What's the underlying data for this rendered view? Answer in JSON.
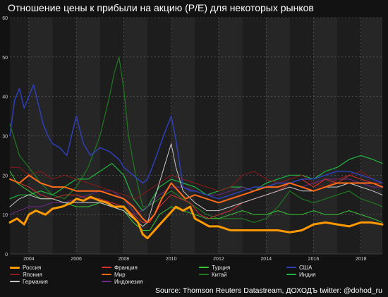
{
  "chart_data": {
    "type": "line",
    "title": "Отношение цены к прибыли на акцию (P/E) для некоторых рынков",
    "source": "Source: Thomson Reuters Datastream, ДОХОДЪ twitter: @dohod_ru",
    "xlim": [
      2003.2,
      2018.9
    ],
    "ylim": [
      0,
      60
    ],
    "x_ticks": [
      "2004",
      "2006",
      "2008",
      "2010",
      "2012",
      "2014",
      "2016",
      "2018"
    ],
    "y_ticks": [
      "0",
      "10",
      "20",
      "30",
      "40",
      "50",
      "60"
    ],
    "grid": true,
    "legend_position": "bottom",
    "series": [
      {
        "name": "Россия",
        "color": "#ff9900",
        "width": 3.0,
        "x": [
          2003.2,
          2003.5,
          2003.8,
          2004.0,
          2004.3,
          2004.7,
          2005.0,
          2005.4,
          2005.8,
          2006.0,
          2006.3,
          2006.6,
          2007.0,
          2007.3,
          2007.6,
          2008.0,
          2008.3,
          2008.6,
          2008.8,
          2009.0,
          2009.3,
          2009.6,
          2009.9,
          2010.2,
          2010.5,
          2010.8,
          2011.0,
          2011.3,
          2011.6,
          2012.0,
          2012.5,
          2013.0,
          2013.5,
          2014.0,
          2014.5,
          2015.0,
          2015.5,
          2016.0,
          2016.5,
          2017.0,
          2017.5,
          2018.0,
          2018.4,
          2018.9
        ],
        "y": [
          8,
          9,
          7.5,
          10,
          11,
          10,
          11.5,
          12,
          13,
          14,
          13.5,
          14.5,
          13.5,
          13,
          12,
          12,
          10,
          8,
          5,
          4,
          6,
          8,
          10,
          12,
          11,
          12,
          9,
          8,
          7,
          7,
          6,
          6,
          6,
          6,
          6,
          5.5,
          6,
          7.5,
          8,
          7.5,
          7,
          8,
          8,
          7.5
        ]
      },
      {
        "name": "Франция",
        "color": "#d92f2f",
        "width": 1.0,
        "x": [
          2003.2,
          2003.6,
          2004.0,
          2004.5,
          2005.0,
          2005.5,
          2006.0,
          2006.5,
          2007.0,
          2007.5,
          2008.0,
          2008.4,
          2008.8,
          2009.1,
          2009.5,
          2010.0,
          2010.4,
          2010.8,
          2011.2,
          2011.6,
          2012.0,
          2012.5,
          2013.0,
          2013.5,
          2014.0,
          2014.5,
          2015.0,
          2015.5,
          2016.0,
          2016.5,
          2017.0,
          2017.5,
          2018.0,
          2018.5,
          2018.9
        ],
        "y": [
          19,
          18,
          17,
          15,
          14,
          15,
          15,
          14,
          14,
          13,
          12,
          10,
          8,
          8,
          12,
          15,
          14,
          13,
          10,
          9,
          10,
          11,
          13,
          14,
          15,
          16,
          18,
          19,
          17,
          19,
          18,
          20,
          19,
          18,
          18
        ]
      },
      {
        "name": "Турция",
        "color": "#37c837",
        "width": 1.0,
        "x": [
          2003.2,
          2003.5,
          2004.0,
          2004.5,
          2005.0,
          2005.5,
          2006.0,
          2006.5,
          2007.0,
          2007.5,
          2008.0,
          2008.4,
          2008.8,
          2009.1,
          2009.5,
          2010.0,
          2010.5,
          2011.0,
          2011.5,
          2012.0,
          2012.5,
          2013.0,
          2013.5,
          2014.0,
          2014.5,
          2015.0,
          2015.5,
          2016.0,
          2016.5,
          2017.0,
          2017.5,
          2018.0,
          2018.5,
          2018.9
        ],
        "y": [
          21,
          18,
          16,
          14,
          14,
          13,
          12,
          12,
          13,
          12,
          11,
          8,
          6,
          6,
          10,
          12,
          11,
          10,
          9,
          9,
          10,
          11,
          10,
          10,
          11,
          10,
          10,
          11,
          10,
          10,
          11,
          10,
          9,
          8
        ]
      },
      {
        "name": "США",
        "color": "#2e3fb8",
        "width": 1.5,
        "x": [
          2003.2,
          2003.4,
          2003.6,
          2003.8,
          2004.0,
          2004.2,
          2004.4,
          2004.6,
          2004.8,
          2005.0,
          2005.3,
          2005.6,
          2006.0,
          2006.3,
          2006.6,
          2007.0,
          2007.4,
          2007.8,
          2008.0,
          2008.4,
          2008.8,
          2009.0,
          2009.2,
          2009.5,
          2009.8,
          2010.0,
          2010.2,
          2010.5,
          2010.8,
          2011.0,
          2011.5,
          2012.0,
          2012.5,
          2013.0,
          2013.5,
          2014.0,
          2014.5,
          2015.0,
          2015.5,
          2016.0,
          2016.5,
          2017.0,
          2017.5,
          2018.0,
          2018.5,
          2018.9
        ],
        "y": [
          30,
          39,
          42,
          37,
          40,
          43,
          38,
          33,
          30,
          28,
          27,
          25,
          35,
          28,
          25,
          27,
          26,
          24,
          22,
          20,
          18,
          19,
          22,
          27,
          32,
          35,
          29,
          17,
          16,
          16,
          15,
          14,
          15,
          16,
          17,
          17,
          18,
          18,
          19,
          19,
          20,
          21,
          21,
          20,
          19,
          18
        ]
      },
      {
        "name": "Япония",
        "color": "#8b1a1a",
        "width": 1.0,
        "x": [
          2003.2,
          2003.6,
          2004.0,
          2004.5,
          2005.0,
          2005.5,
          2006.0,
          2006.5,
          2007.0,
          2007.5,
          2008.0,
          2008.5,
          2009.0,
          2009.5,
          2010.0,
          2010.5,
          2011.0,
          2011.5,
          2012.0,
          2012.5,
          2013.0,
          2013.5,
          2014.0,
          2014.5,
          2015.0,
          2015.5,
          2016.0,
          2016.5,
          2017.0,
          2017.5,
          2018.0,
          2018.5,
          2018.9
        ],
        "y": [
          22,
          22,
          20,
          21,
          19,
          20,
          19,
          18,
          17,
          16,
          15,
          14,
          16,
          18,
          20,
          19,
          18,
          17,
          16,
          17,
          20,
          21,
          19,
          18,
          19,
          20,
          18,
          17,
          19,
          20,
          21,
          19,
          18
        ]
      },
      {
        "name": "Мир",
        "color": "#ff6b18",
        "width": 2.0,
        "x": [
          2003.2,
          2003.6,
          2004.0,
          2004.5,
          2005.0,
          2005.5,
          2006.0,
          2006.5,
          2007.0,
          2007.5,
          2008.0,
          2008.4,
          2008.8,
          2009.0,
          2009.3,
          2009.6,
          2010.0,
          2010.3,
          2010.6,
          2011.0,
          2011.5,
          2012.0,
          2012.5,
          2013.0,
          2013.5,
          2014.0,
          2014.5,
          2015.0,
          2015.5,
          2016.0,
          2016.5,
          2017.0,
          2017.5,
          2018.0,
          2018.5,
          2018.9
        ],
        "y": [
          19,
          18,
          20,
          18,
          17,
          17,
          16,
          16,
          16,
          15,
          14,
          12,
          9,
          8,
          10,
          14,
          18,
          16,
          14,
          15,
          14,
          13,
          14,
          15,
          16,
          17,
          17,
          18,
          17,
          16,
          17,
          18,
          18,
          18,
          18,
          17
        ]
      },
      {
        "name": "Китай",
        "color": "#1f7a1f",
        "width": 1.2,
        "x": [
          2003.2,
          2003.6,
          2004.0,
          2004.5,
          2005.0,
          2005.5,
          2006.0,
          2006.5,
          2007.0,
          2007.4,
          2007.6,
          2007.8,
          2008.0,
          2008.2,
          2008.5,
          2008.8,
          2009.0,
          2009.5,
          2010.0,
          2010.5,
          2011.0,
          2011.5,
          2012.0,
          2012.5,
          2013.0,
          2013.5,
          2014.0,
          2014.5,
          2015.0,
          2015.5,
          2016.0,
          2016.5,
          2017.0,
          2017.5,
          2018.0,
          2018.5,
          2018.9
        ],
        "y": [
          33,
          25,
          22,
          18,
          15,
          14,
          17,
          22,
          30,
          40,
          46,
          50,
          42,
          30,
          20,
          12,
          12,
          14,
          16,
          14,
          12,
          10,
          9,
          9,
          9,
          8,
          9,
          12,
          16,
          14,
          13,
          14,
          15,
          16,
          14,
          13,
          12
        ]
      },
      {
        "name": "Индия",
        "color": "#20b540",
        "width": 1.2,
        "x": [
          2003.2,
          2003.6,
          2004.0,
          2004.5,
          2005.0,
          2005.5,
          2006.0,
          2006.5,
          2007.0,
          2007.5,
          2008.0,
          2008.4,
          2008.8,
          2009.0,
          2009.5,
          2010.0,
          2010.5,
          2011.0,
          2011.5,
          2012.0,
          2012.5,
          2013.0,
          2013.5,
          2014.0,
          2014.5,
          2015.0,
          2015.5,
          2016.0,
          2016.5,
          2017.0,
          2017.5,
          2018.0,
          2018.5,
          2018.9
        ],
        "y": [
          14,
          15,
          15,
          16,
          15,
          17,
          19,
          19,
          21,
          23,
          20,
          14,
          11,
          12,
          17,
          19,
          18,
          17,
          15,
          16,
          17,
          17,
          16,
          18,
          19,
          20,
          20,
          19,
          21,
          22,
          24,
          25,
          24,
          23
        ]
      },
      {
        "name": "Германия",
        "color": "#c8c8c8",
        "width": 1.0,
        "x": [
          2003.2,
          2003.6,
          2004.0,
          2004.5,
          2005.0,
          2005.5,
          2006.0,
          2006.5,
          2007.0,
          2007.5,
          2008.0,
          2008.4,
          2008.8,
          2009.0,
          2009.3,
          2009.6,
          2009.9,
          2010.0,
          2010.2,
          2010.5,
          2011.0,
          2011.5,
          2012.0,
          2012.5,
          2013.0,
          2013.5,
          2014.0,
          2014.5,
          2015.0,
          2015.5,
          2016.0,
          2016.5,
          2017.0,
          2017.5,
          2018.0,
          2018.5,
          2018.9
        ],
        "y": [
          12,
          14,
          15,
          14,
          14,
          13,
          13,
          13,
          13,
          12,
          11,
          9,
          7,
          8,
          14,
          20,
          26,
          28,
          22,
          16,
          13,
          11,
          11,
          12,
          13,
          14,
          15,
          16,
          17,
          16,
          16,
          17,
          17,
          18,
          17,
          16,
          15
        ]
      },
      {
        "name": "Индонезия",
        "color": "#6f2a8f",
        "width": 1.0,
        "x": [
          2003.2,
          2003.6,
          2004.0,
          2004.5,
          2005.0,
          2005.5,
          2006.0,
          2006.5,
          2007.0,
          2007.5,
          2008.0,
          2008.5,
          2009.0,
          2009.5,
          2010.0,
          2010.5,
          2011.0,
          2011.5,
          2012.0,
          2012.5,
          2013.0,
          2013.5,
          2014.0,
          2014.5,
          2015.0,
          2015.5,
          2016.0,
          2016.5,
          2017.0,
          2017.5,
          2018.0,
          2018.5,
          2018.9
        ],
        "y": [
          10,
          11,
          12,
          12,
          13,
          13,
          14,
          15,
          16,
          16,
          14,
          10,
          12,
          15,
          17,
          17,
          16,
          15,
          15,
          16,
          17,
          16,
          17,
          18,
          18,
          17,
          18,
          19,
          19,
          19,
          18,
          17,
          17
        ]
      }
    ]
  }
}
